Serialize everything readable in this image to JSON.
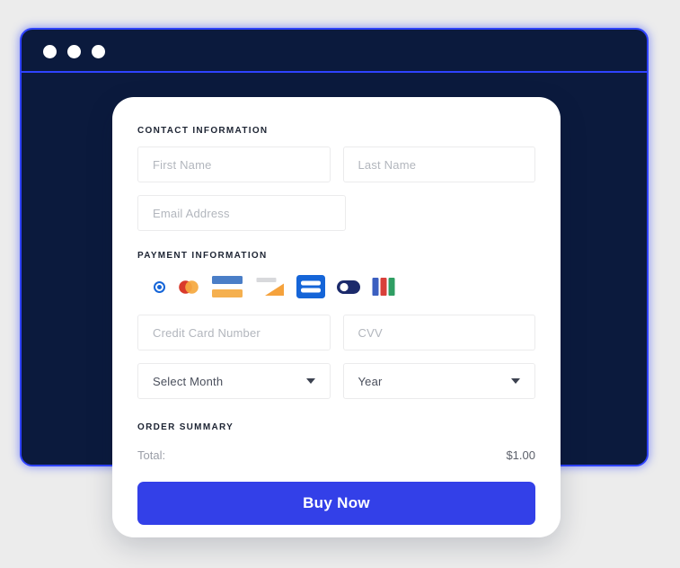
{
  "window": {
    "dots": [
      "window-dot-1",
      "window-dot-2",
      "window-dot-3"
    ],
    "border_color": "#2f43ff",
    "background_color": "#0b1a3d"
  },
  "contact": {
    "heading": "CONTACT INFORMATION",
    "first_name_placeholder": "First Name",
    "last_name_placeholder": "Last Name",
    "email_placeholder": "Email Address",
    "first_name_value": "",
    "last_name_value": "",
    "email_value": ""
  },
  "payment": {
    "heading": "PAYMENT INFORMATION",
    "selected_method": "radio-selected",
    "brands": [
      {
        "name": "mastercard",
        "label": "Mastercard"
      },
      {
        "name": "visa",
        "label": "Visa"
      },
      {
        "name": "discover",
        "label": "Discover"
      },
      {
        "name": "amex",
        "label": "American Express"
      },
      {
        "name": "diners-club",
        "label": "Diners Club"
      },
      {
        "name": "jcb",
        "label": "JCB"
      }
    ],
    "card_number_placeholder": "Credit Card Number",
    "cvv_placeholder": "CVV",
    "card_number_value": "",
    "cvv_value": "",
    "month_selected": "Select Month",
    "year_selected": "Year"
  },
  "order_summary": {
    "heading": "ORDER SUMMARY",
    "total_label": "Total:",
    "total_value": "$1.00"
  },
  "actions": {
    "buy_label": "Buy Now",
    "buy_color": "#3340e8"
  }
}
